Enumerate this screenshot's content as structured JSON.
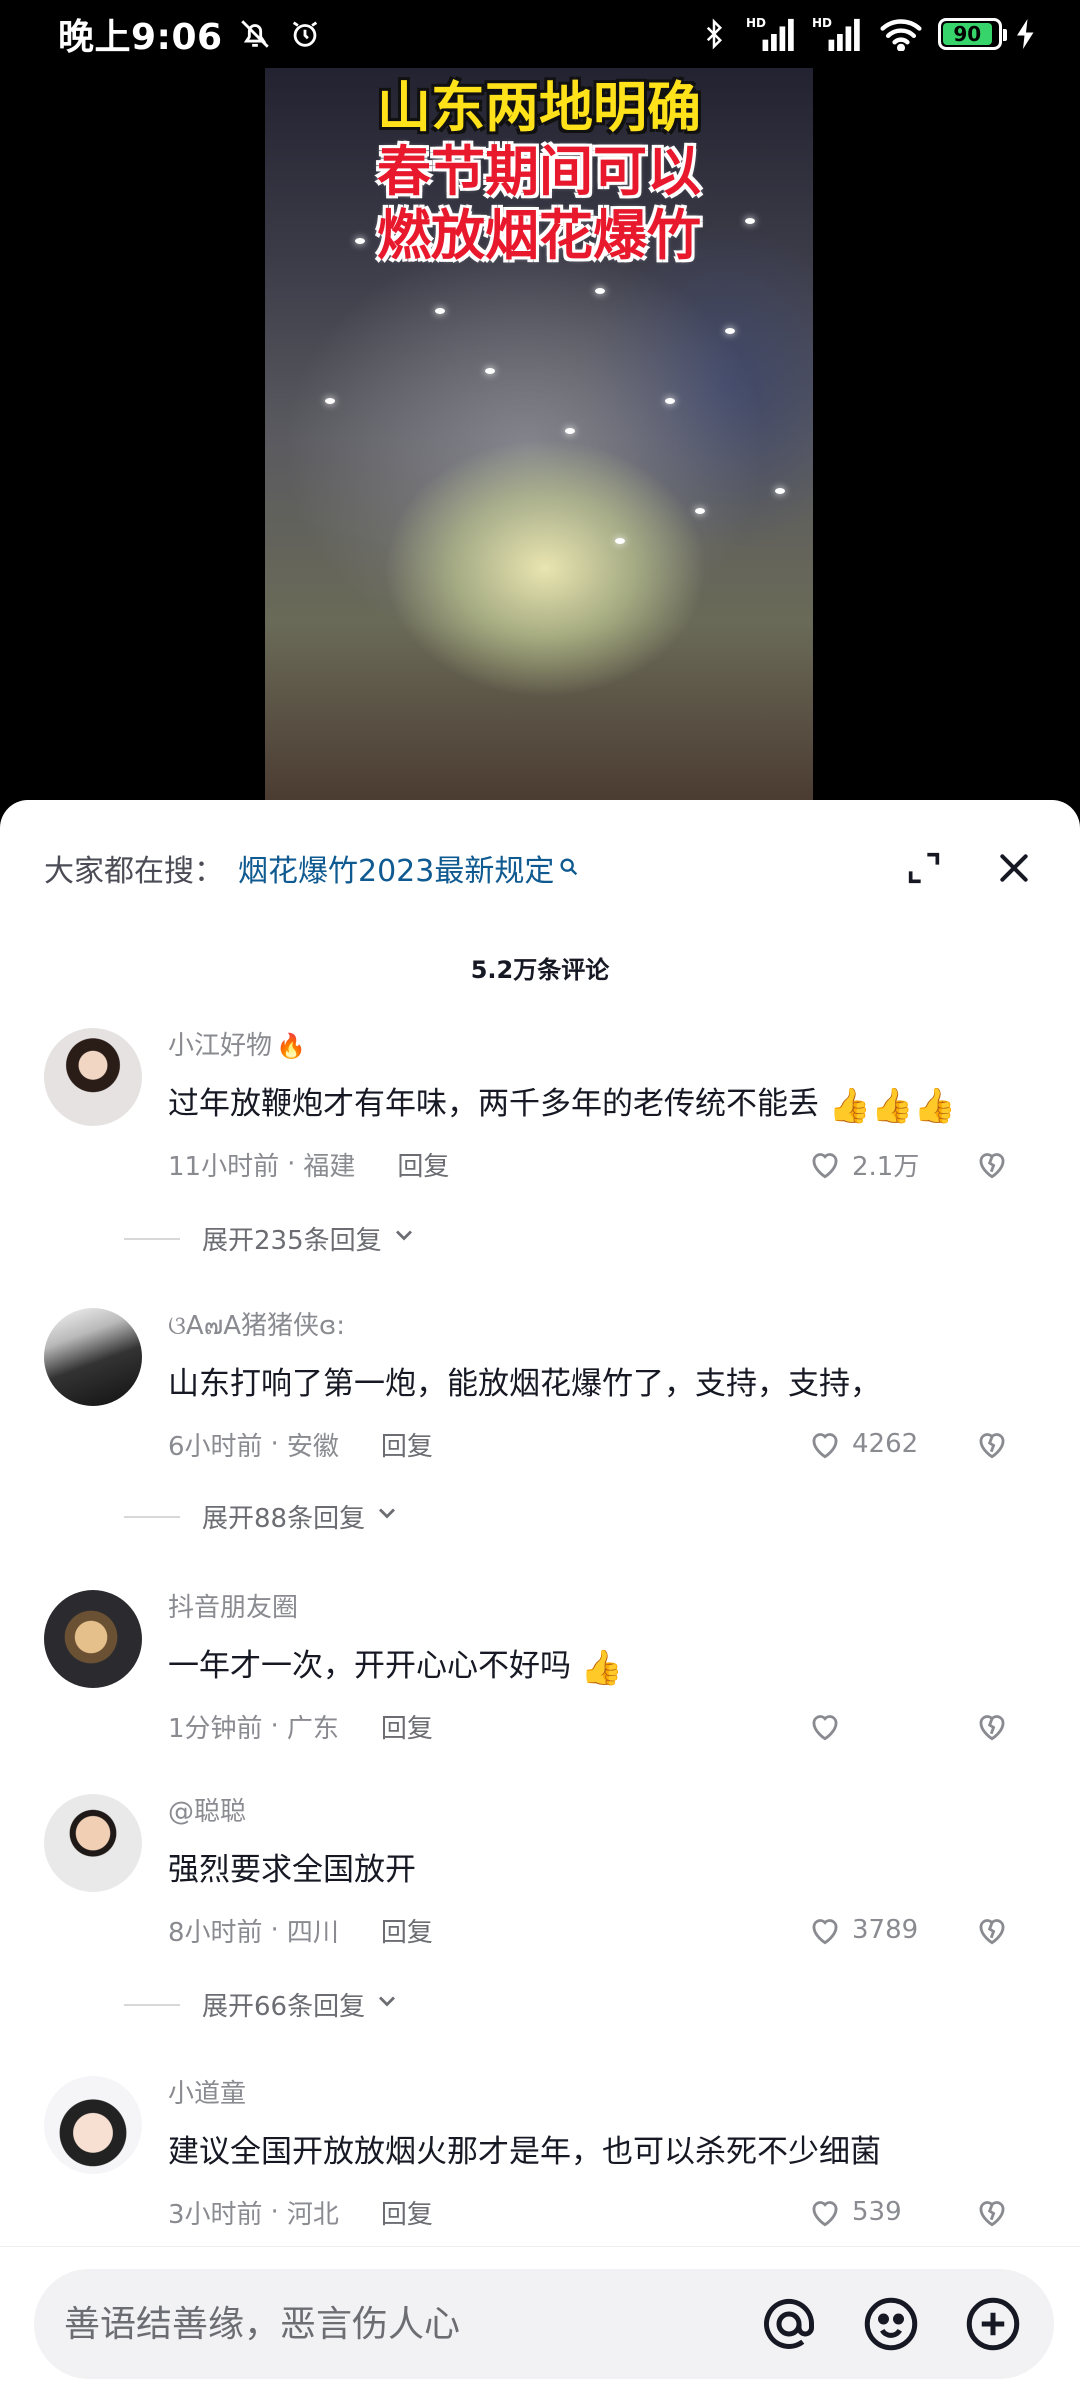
{
  "status_bar": {
    "time": "晚上9:06",
    "battery": "90",
    "hd1": "HD",
    "hd2": "HD"
  },
  "video": {
    "headline_lines": [
      "山东两地明确",
      "春节期间可以",
      "燃放烟花爆竹"
    ]
  },
  "search": {
    "prefix": "大家都在搜：",
    "query": "烟花爆竹2023最新规定"
  },
  "comment_count": "5.2万条评论",
  "comments": [
    {
      "username": "小江好物",
      "text": "过年放鞭炮才有年味，两千多年的老传统不能丢",
      "time": "11小时前",
      "location": "福建",
      "reply_label": "回复",
      "likes": "2.1万",
      "expand": "展开235条回复"
    },
    {
      "username": "ଓA๗A猪猪侠ɞ:",
      "text": "山东打响了第一炮，能放烟花爆竹了，支持，支持，",
      "time": "6小时前",
      "location": "安徽",
      "reply_label": "回复",
      "likes": "4262",
      "expand": "展开88条回复"
    },
    {
      "username": "抖音朋友圈",
      "text": "一年才一次，开开心心不好吗",
      "time": "1分钟前",
      "location": "广东",
      "reply_label": "回复",
      "likes": "",
      "expand": ""
    },
    {
      "username": "@聪聪",
      "text": "强烈要求全国放开",
      "time": "8小时前",
      "location": "四川",
      "reply_label": "回复",
      "likes": "3789",
      "expand": "展开66条回复"
    },
    {
      "username": "小道童",
      "text": "建议全国开放放烟火那才是年，也可以杀死不少细菌",
      "time": "3小时前",
      "location": "河北",
      "reply_label": "回复",
      "likes": "539",
      "expand": ""
    }
  ],
  "input": {
    "placeholder": "善语结善缘，恶言伤人心"
  },
  "colors": {
    "link": "#0f5a90",
    "muted": "#8a8b91",
    "headline_yellow": "#ffe21a",
    "headline_red": "#e8192c"
  },
  "icons": {
    "status_left": [
      "mute-icon",
      "alarm-icon"
    ],
    "status_right": [
      "bluetooth-icon",
      "signal-icon",
      "signal-icon",
      "wifi-icon",
      "battery-icon",
      "charging-icon"
    ],
    "sheet": [
      "expand-icon",
      "close-icon"
    ],
    "input": [
      "at-icon",
      "emoji-icon",
      "add-icon"
    ]
  }
}
